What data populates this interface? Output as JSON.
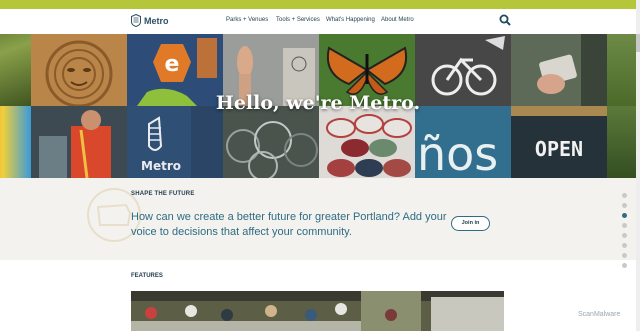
{
  "header": {
    "logo_text": "Metro",
    "nav": [
      "Parks + Venues",
      "Tools + Services",
      "What's Happening",
      "About Metro"
    ]
  },
  "hero": {
    "title": "Hello, we're Metro.",
    "tiles": [
      {
        "name": "hero-tile-grass"
      },
      {
        "name": "hero-tile-wood-mask"
      },
      {
        "name": "hero-tile-metro-signs"
      },
      {
        "name": "hero-tile-raised-hand"
      },
      {
        "name": "hero-tile-butterfly"
      },
      {
        "name": "hero-tile-bike-lane"
      },
      {
        "name": "hero-tile-hand-card"
      },
      {
        "name": "hero-tile-crops"
      },
      {
        "name": "hero-tile-colorful-building"
      },
      {
        "name": "hero-tile-worker"
      },
      {
        "name": "hero-tile-metro-shirt"
      },
      {
        "name": "hero-tile-bikes"
      },
      {
        "name": "hero-tile-paint-cans"
      },
      {
        "name": "hero-tile-nos-sign"
      },
      {
        "name": "hero-tile-open-sign"
      },
      {
        "name": "hero-tile-plants"
      }
    ],
    "open_sign_text": "OPEN",
    "nos_sign_text": "ños",
    "shirt_text": "Metro",
    "shirt_text_2": "Metro"
  },
  "shape_future": {
    "label": "SHAPE THE FUTURE",
    "text": "How can we create a better future for greater Portland? Add your voice to decisions that affect your community.",
    "button": "Join in"
  },
  "features": {
    "label": "FEATURES"
  },
  "page_nav": {
    "count": 8,
    "active_index": 2
  },
  "watermark": "ScanMalware",
  "colors": {
    "accent_strip": "#b6c63a",
    "brand": "#2f6c82",
    "panel_bg": "#f3f2ef"
  }
}
